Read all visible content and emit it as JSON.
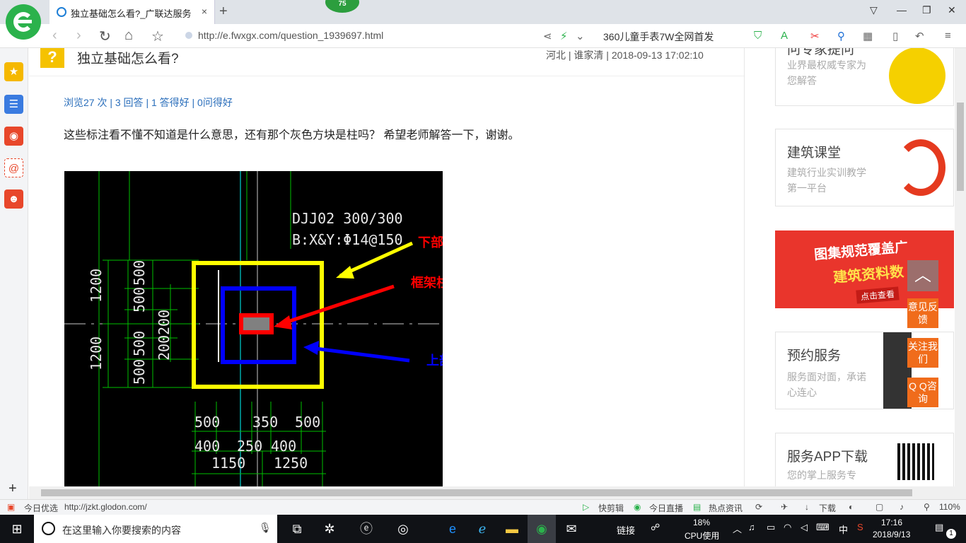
{
  "browser": {
    "badge": "75",
    "tab_title": "独立基础怎么看?_广联达服务新",
    "tab_close": "×",
    "new_tab": "+",
    "url": "http://e.fwxgx.com/question_1939697.html",
    "promo_text": "360儿童手表7W全网首发"
  },
  "question": {
    "icon": "?",
    "title": "独立基础怎么看?",
    "meta": "河北 | 谁家清 | 2018-09-13 17:02:10",
    "stats": "浏览27 次 | 3 回答 | 1 答得好 | 0问得好",
    "body": "这些标注看不懂不知道是什么意思，还有那个灰色方块是柱吗？    希望老师解答一下，谢谢。"
  },
  "drawing": {
    "label_code": "DJJ02 300/300",
    "label_rebar": "B:X&Y:Φ14@150",
    "anno_yellow": "下部一阶尺寸",
    "anno_red": "框架柱",
    "anno_blue": "上部一阶尺寸",
    "dims_left": [
      "1200",
      "1200",
      "500",
      "500",
      "500",
      "500",
      "200",
      "200"
    ],
    "dims_bottom_top": [
      "500",
      "350",
      "500"
    ],
    "dims_bottom_mid": [
      "400",
      "250",
      "400"
    ],
    "dims_bottom_low": [
      "1150",
      "1250"
    ],
    "colors": {
      "yellow": "#ffff00",
      "blue": "#0000ff",
      "red": "#ff0000",
      "green": "#00c000"
    }
  },
  "sidebar_right": {
    "card1": {
      "title": "问专家提问",
      "desc": "业界最权威专家为您解答"
    },
    "card2": {
      "title": "建筑课堂",
      "desc": "建筑行业实训教学第一平台"
    },
    "banner": {
      "line1": "图集规范覆盖广",
      "line2": "建筑资料数",
      "button": "点击查看"
    },
    "card3": {
      "title": "预约服务",
      "desc": "服务面对面，承诺心连心"
    },
    "card4": {
      "title": "服务APP下载",
      "desc": "您的掌上服务专"
    },
    "float_buttons": [
      "意见反馈",
      "关注我们",
      "Q Q咨询"
    ]
  },
  "statusbar": {
    "left_label": "今日优选",
    "status_url": "http://jzkt.glodon.com/",
    "items": [
      "快剪辑",
      "今日直播",
      "热点资讯",
      "下载"
    ],
    "zoom": "110%"
  },
  "taskbar": {
    "search_placeholder": "在这里输入你要搜索的内容",
    "links_label": "链接",
    "cpu_percent": "18%",
    "cpu_label": "CPU使用",
    "ime": "中",
    "time": "17:16",
    "date": "2018/9/13",
    "notifications": "1"
  }
}
